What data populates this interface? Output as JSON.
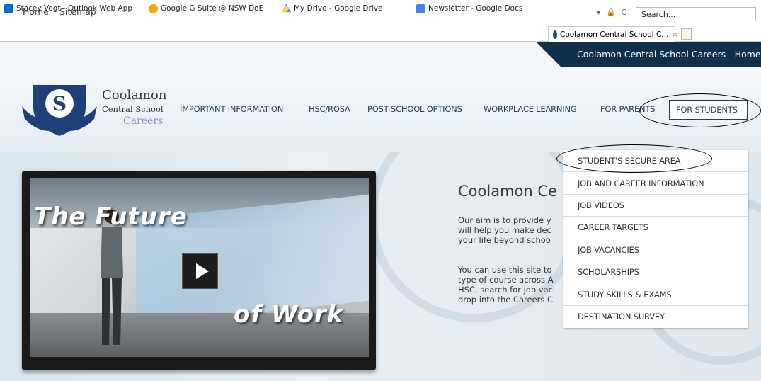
{
  "browser": {
    "search_placeholder": "Search...",
    "address_icons": "▾ 🔒 C",
    "favorites": [
      {
        "label": "Stacey Vogt - Outlook Web App",
        "icon": "outlook-icon",
        "color": "#0072c6"
      },
      {
        "label": "Google G Suite @ NSW DoE",
        "icon": "ie-icon",
        "color": "#f0a70a"
      },
      {
        "label": "My Drive - Google Drive",
        "icon": "drive-icon",
        "color": "#1fa463"
      },
      {
        "label": "Newsletter - Google Docs",
        "icon": "docs-icon",
        "color": "#4285f4"
      }
    ],
    "active_tab": {
      "label": "Coolamon Central School C...",
      "close": "×"
    }
  },
  "site": {
    "util_links": [
      "Home",
      "Sitemap"
    ],
    "strip_title": "Coolamon Central School Careers - Home",
    "logo": {
      "title": "Coolamon",
      "subtitle": "Central School",
      "careers": "Careers"
    },
    "nav": [
      "IMPORTANT INFORMATION",
      "HSC/ROSA",
      "POST SCHOOL OPTIONS",
      "WORKPLACE LEARNING",
      "FOR PARENTS",
      "FOR STUDENTS"
    ],
    "dropdown": [
      "STUDENT'S SECURE AREA",
      "JOB AND CAREER INFORMATION",
      "JOB VIDEOS",
      "CAREER TARGETS",
      "JOB VACANCIES",
      "SCHOLARSHIPS",
      "STUDY SKILLS & EXAMS",
      "DESTINATION SURVEY"
    ],
    "video": {
      "text_top": "The Future",
      "text_bottom": "of Work"
    },
    "welcome": {
      "title": "Coolamon Ce",
      "para1": "Our aim is to provide y\nwill help you make dec\nyour life beyond schoo",
      "para2": "You can use this site to\ntype of course across A\nHSC, search for job vac\ndrop into the Careers C"
    }
  },
  "colors": {
    "accent_dark": "#0f2f4b",
    "nav_text": "#2b3f55"
  }
}
